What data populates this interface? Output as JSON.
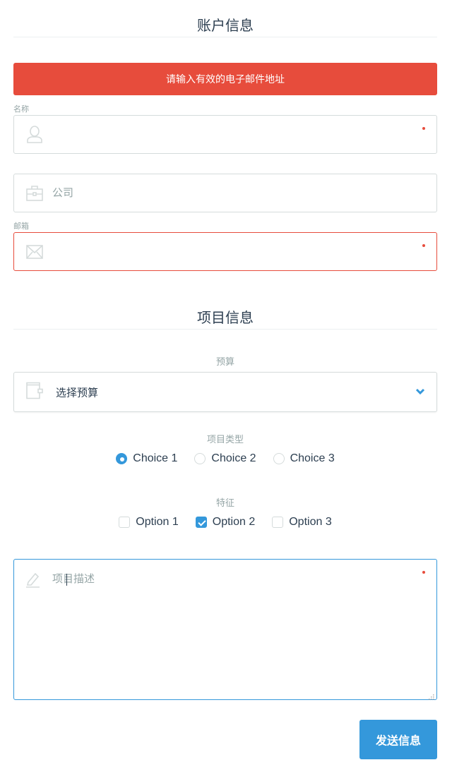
{
  "account_section": {
    "title": "账户信息",
    "alert": "请输入有效的电子邮件地址",
    "name_field": {
      "label": "名称",
      "value": "",
      "placeholder": "",
      "required": true
    },
    "company_field": {
      "label": "",
      "value": "",
      "placeholder": "公司",
      "required": false
    },
    "email_field": {
      "label": "邮箱",
      "value": "",
      "placeholder": "",
      "required": true,
      "state": "error"
    }
  },
  "project_section": {
    "title": "项目信息",
    "budget": {
      "label": "预算",
      "selected": "选择预算"
    },
    "project_type": {
      "label": "项目类型",
      "choices": [
        {
          "label": "Choice 1",
          "checked": true
        },
        {
          "label": "Choice 2",
          "checked": false
        },
        {
          "label": "Choice 3",
          "checked": false
        }
      ]
    },
    "features": {
      "label": "特征",
      "options": [
        {
          "label": "Option 1",
          "checked": false
        },
        {
          "label": "Option 2",
          "checked": true
        },
        {
          "label": "Option 3",
          "checked": false
        }
      ]
    },
    "description": {
      "value": "",
      "placeholder": "项目描述",
      "required": true
    }
  },
  "submit_label": "发送信息",
  "colors": {
    "accent": "#3498db",
    "error": "#e74c3c",
    "text": "#2c3e50",
    "muted": "#95a5a6",
    "border": "#d5dbdb"
  }
}
